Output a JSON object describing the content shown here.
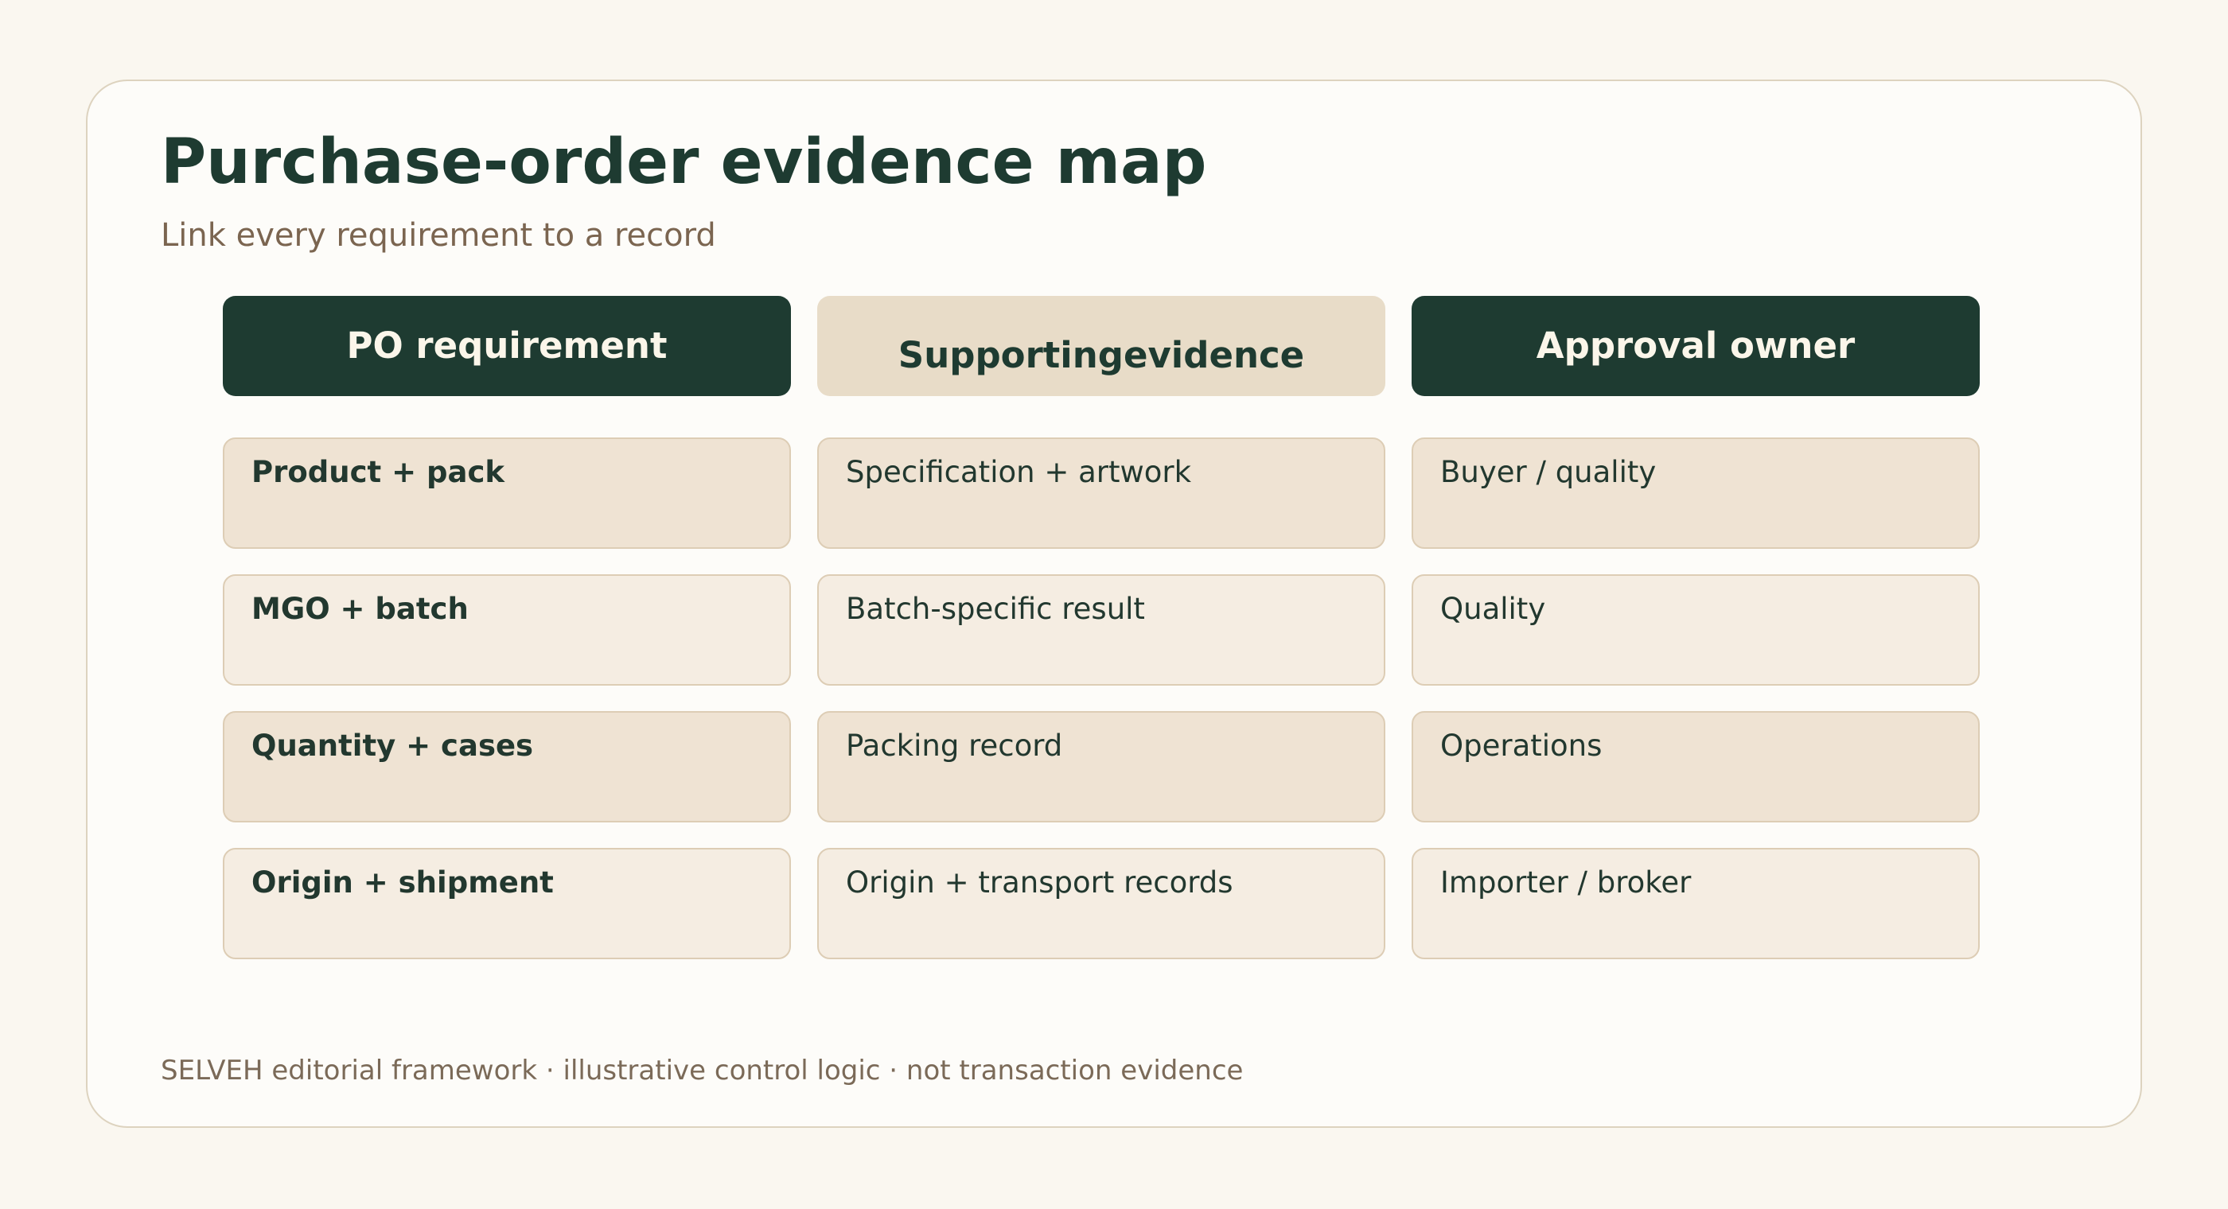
{
  "title": "Purchase-order evidence map",
  "subtitle": "Link every requirement to a record",
  "columns": [
    {
      "label": "PO requirement"
    },
    {
      "label_lines": [
        "Supporting",
        "evidence"
      ]
    },
    {
      "label": "Approval owner"
    }
  ],
  "rows": [
    {
      "requirement": "Product + pack",
      "evidence": "Specification + artwork",
      "owner": "Buyer / quality"
    },
    {
      "requirement": "MGO + batch",
      "evidence": "Batch-specific result",
      "owner": "Quality"
    },
    {
      "requirement": "Quantity + cases",
      "evidence": "Packing record",
      "owner": "Operations"
    },
    {
      "requirement": "Origin + shipment",
      "evidence": "Origin + transport records",
      "owner": "Importer / broker"
    }
  ],
  "footer": "SELVEH editorial framework · illustrative control logic · not transaction evidence",
  "colors": {
    "page_background": "#faf7f0",
    "card_background": "#fdfcf9",
    "dark_green": "#1e3b31",
    "header_beige": "#e8dcc8",
    "row_odd": "#efe3d3",
    "row_even": "#f5ede2",
    "subtitle_brown": "#7b6550"
  }
}
